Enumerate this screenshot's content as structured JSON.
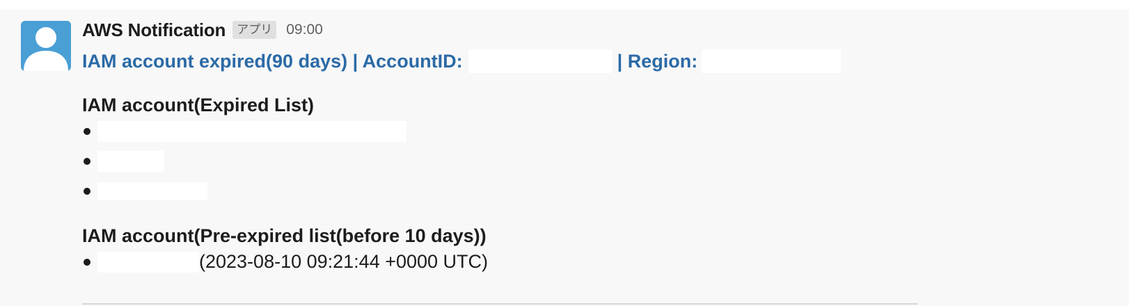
{
  "message": {
    "sender": "AWS Notification",
    "badge": "アプリ",
    "time": "09:00",
    "title_part1": "IAM account expired(90 days) | AccountID:",
    "title_part2": "| Region:",
    "section_expired_title": "IAM account(Expired List)",
    "section_pre_expired_title": "IAM account(Pre-expired list(before 10 days))",
    "pre_expired_items": [
      {
        "detail": "(2023-08-10 09:21:44 +0000 UTC)"
      }
    ]
  },
  "colors": {
    "link": "#2b6aa6",
    "avatar_bg": "#4a9fd5",
    "background": "#f8f8f8"
  },
  "icons": {
    "avatar": "user-avatar-icon"
  }
}
